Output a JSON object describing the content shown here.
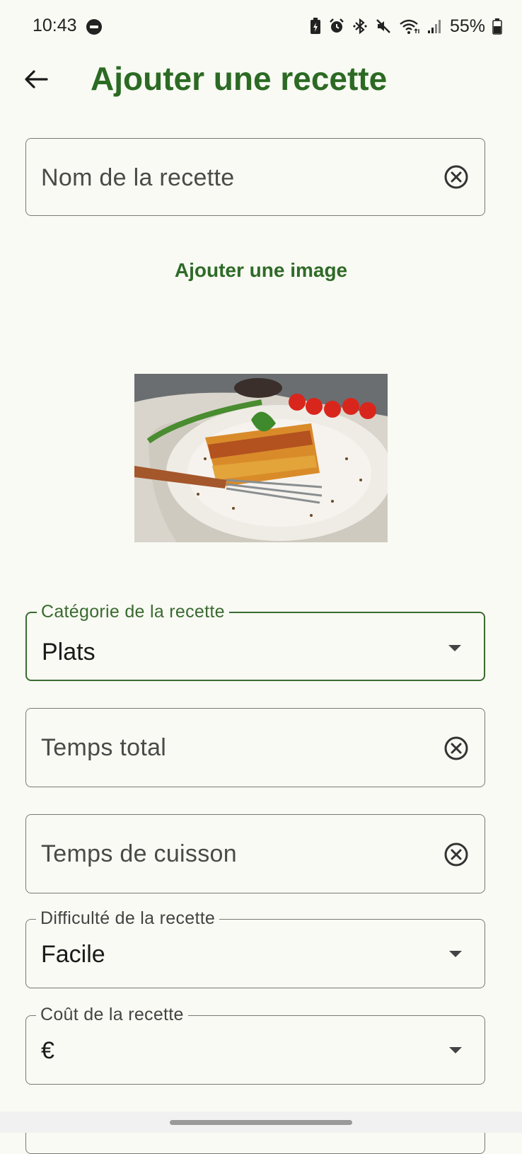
{
  "status_bar": {
    "time": "10:43",
    "battery": "55%"
  },
  "app_bar": {
    "title": "Ajouter une recette"
  },
  "form": {
    "recipe_name": {
      "placeholder": "Nom de la recette"
    },
    "add_image_label": "Ajouter une image",
    "category": {
      "label": "Catégorie de la recette",
      "value": "Plats"
    },
    "total_time": {
      "placeholder": "Temps total"
    },
    "cooking_time": {
      "placeholder": "Temps de cuisson"
    },
    "difficulty": {
      "label": "Difficulté de la recette",
      "value": "Facile"
    },
    "cost": {
      "label": "Coût de la recette",
      "value": "€"
    }
  },
  "colors": {
    "accent": "#2c6a24",
    "background": "#f8faf3",
    "outline": "#7a7a76"
  },
  "icons": [
    "back-arrow-icon",
    "clear-icon",
    "dropdown-caret-icon",
    "dnd-icon",
    "wifi-icon",
    "signal-icon",
    "bluetooth-icon",
    "alarm-icon",
    "mute-icon",
    "battery-icon"
  ]
}
